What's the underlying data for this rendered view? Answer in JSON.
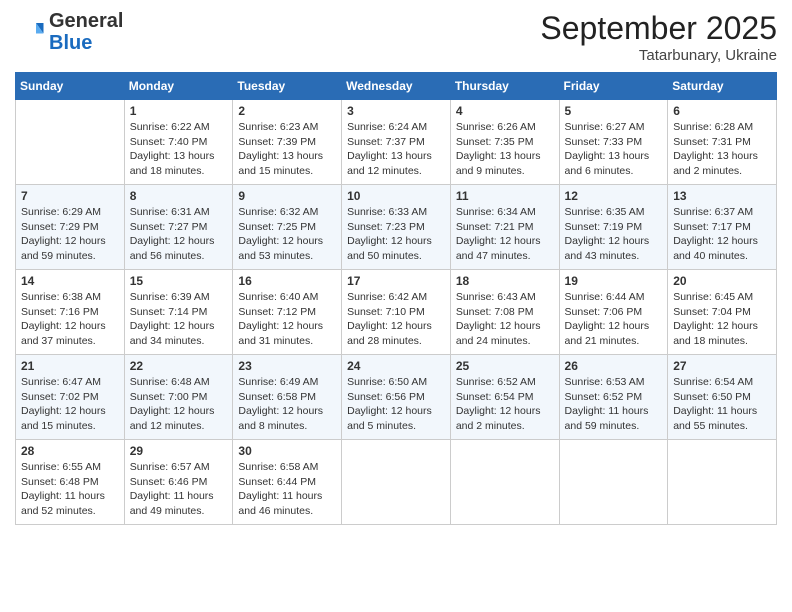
{
  "logo": {
    "general": "General",
    "blue": "Blue"
  },
  "header": {
    "month": "September 2025",
    "location": "Tatarbunary, Ukraine"
  },
  "columns": [
    "Sunday",
    "Monday",
    "Tuesday",
    "Wednesday",
    "Thursday",
    "Friday",
    "Saturday"
  ],
  "weeks": [
    [
      {
        "day": "",
        "info": ""
      },
      {
        "day": "1",
        "info": "Sunrise: 6:22 AM\nSunset: 7:40 PM\nDaylight: 13 hours\nand 18 minutes."
      },
      {
        "day": "2",
        "info": "Sunrise: 6:23 AM\nSunset: 7:39 PM\nDaylight: 13 hours\nand 15 minutes."
      },
      {
        "day": "3",
        "info": "Sunrise: 6:24 AM\nSunset: 7:37 PM\nDaylight: 13 hours\nand 12 minutes."
      },
      {
        "day": "4",
        "info": "Sunrise: 6:26 AM\nSunset: 7:35 PM\nDaylight: 13 hours\nand 9 minutes."
      },
      {
        "day": "5",
        "info": "Sunrise: 6:27 AM\nSunset: 7:33 PM\nDaylight: 13 hours\nand 6 minutes."
      },
      {
        "day": "6",
        "info": "Sunrise: 6:28 AM\nSunset: 7:31 PM\nDaylight: 13 hours\nand 2 minutes."
      }
    ],
    [
      {
        "day": "7",
        "info": "Sunrise: 6:29 AM\nSunset: 7:29 PM\nDaylight: 12 hours\nand 59 minutes."
      },
      {
        "day": "8",
        "info": "Sunrise: 6:31 AM\nSunset: 7:27 PM\nDaylight: 12 hours\nand 56 minutes."
      },
      {
        "day": "9",
        "info": "Sunrise: 6:32 AM\nSunset: 7:25 PM\nDaylight: 12 hours\nand 53 minutes."
      },
      {
        "day": "10",
        "info": "Sunrise: 6:33 AM\nSunset: 7:23 PM\nDaylight: 12 hours\nand 50 minutes."
      },
      {
        "day": "11",
        "info": "Sunrise: 6:34 AM\nSunset: 7:21 PM\nDaylight: 12 hours\nand 47 minutes."
      },
      {
        "day": "12",
        "info": "Sunrise: 6:35 AM\nSunset: 7:19 PM\nDaylight: 12 hours\nand 43 minutes."
      },
      {
        "day": "13",
        "info": "Sunrise: 6:37 AM\nSunset: 7:17 PM\nDaylight: 12 hours\nand 40 minutes."
      }
    ],
    [
      {
        "day": "14",
        "info": "Sunrise: 6:38 AM\nSunset: 7:16 PM\nDaylight: 12 hours\nand 37 minutes."
      },
      {
        "day": "15",
        "info": "Sunrise: 6:39 AM\nSunset: 7:14 PM\nDaylight: 12 hours\nand 34 minutes."
      },
      {
        "day": "16",
        "info": "Sunrise: 6:40 AM\nSunset: 7:12 PM\nDaylight: 12 hours\nand 31 minutes."
      },
      {
        "day": "17",
        "info": "Sunrise: 6:42 AM\nSunset: 7:10 PM\nDaylight: 12 hours\nand 28 minutes."
      },
      {
        "day": "18",
        "info": "Sunrise: 6:43 AM\nSunset: 7:08 PM\nDaylight: 12 hours\nand 24 minutes."
      },
      {
        "day": "19",
        "info": "Sunrise: 6:44 AM\nSunset: 7:06 PM\nDaylight: 12 hours\nand 21 minutes."
      },
      {
        "day": "20",
        "info": "Sunrise: 6:45 AM\nSunset: 7:04 PM\nDaylight: 12 hours\nand 18 minutes."
      }
    ],
    [
      {
        "day": "21",
        "info": "Sunrise: 6:47 AM\nSunset: 7:02 PM\nDaylight: 12 hours\nand 15 minutes."
      },
      {
        "day": "22",
        "info": "Sunrise: 6:48 AM\nSunset: 7:00 PM\nDaylight: 12 hours\nand 12 minutes."
      },
      {
        "day": "23",
        "info": "Sunrise: 6:49 AM\nSunset: 6:58 PM\nDaylight: 12 hours\nand 8 minutes."
      },
      {
        "day": "24",
        "info": "Sunrise: 6:50 AM\nSunset: 6:56 PM\nDaylight: 12 hours\nand 5 minutes."
      },
      {
        "day": "25",
        "info": "Sunrise: 6:52 AM\nSunset: 6:54 PM\nDaylight: 12 hours\nand 2 minutes."
      },
      {
        "day": "26",
        "info": "Sunrise: 6:53 AM\nSunset: 6:52 PM\nDaylight: 11 hours\nand 59 minutes."
      },
      {
        "day": "27",
        "info": "Sunrise: 6:54 AM\nSunset: 6:50 PM\nDaylight: 11 hours\nand 55 minutes."
      }
    ],
    [
      {
        "day": "28",
        "info": "Sunrise: 6:55 AM\nSunset: 6:48 PM\nDaylight: 11 hours\nand 52 minutes."
      },
      {
        "day": "29",
        "info": "Sunrise: 6:57 AM\nSunset: 6:46 PM\nDaylight: 11 hours\nand 49 minutes."
      },
      {
        "day": "30",
        "info": "Sunrise: 6:58 AM\nSunset: 6:44 PM\nDaylight: 11 hours\nand 46 minutes."
      },
      {
        "day": "",
        "info": ""
      },
      {
        "day": "",
        "info": ""
      },
      {
        "day": "",
        "info": ""
      },
      {
        "day": "",
        "info": ""
      }
    ]
  ]
}
